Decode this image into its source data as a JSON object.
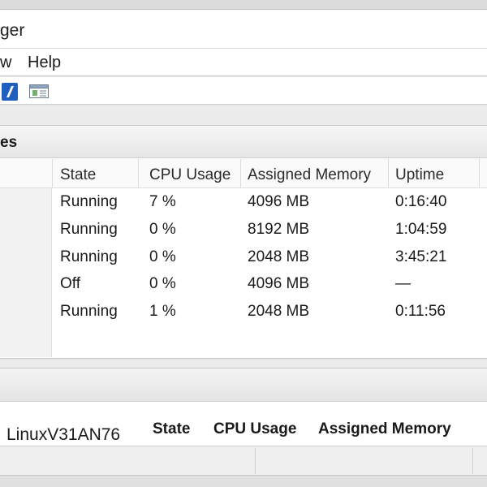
{
  "window": {
    "title_fragment": "ger"
  },
  "menu": {
    "items": [
      "w",
      "Help"
    ]
  },
  "toolbar": {
    "icons": [
      "help-icon",
      "panel-toggle-icon"
    ]
  },
  "vm_pane": {
    "title_fragment": "es",
    "columns": [
      "State",
      "CPU Usage",
      "Assigned Memory",
      "Uptime"
    ],
    "rows": [
      {
        "state": "Running",
        "cpu": "7 %",
        "memory": "4096 MB",
        "uptime": "0:16:40"
      },
      {
        "state": "Running",
        "cpu": "0 %",
        "memory": "8192 MB",
        "uptime": "1:04:59"
      },
      {
        "state": "Running",
        "cpu": "0 %",
        "memory": "2048 MB",
        "uptime": "3:45:21"
      },
      {
        "state": "Off",
        "cpu": "0 %",
        "memory": "4096 MB",
        "uptime": "—"
      },
      {
        "state": "Running",
        "cpu": "1 %",
        "memory": "2048 MB",
        "uptime": "0:11:56"
      }
    ]
  },
  "details": {
    "vm_name": "LinuxV31AN76",
    "headers": [
      "State",
      "CPU Usage",
      "Assigned Memory"
    ]
  },
  "colors": {
    "accent_blue": "#1f5fbf",
    "header_gray": "#e6e6e6"
  }
}
